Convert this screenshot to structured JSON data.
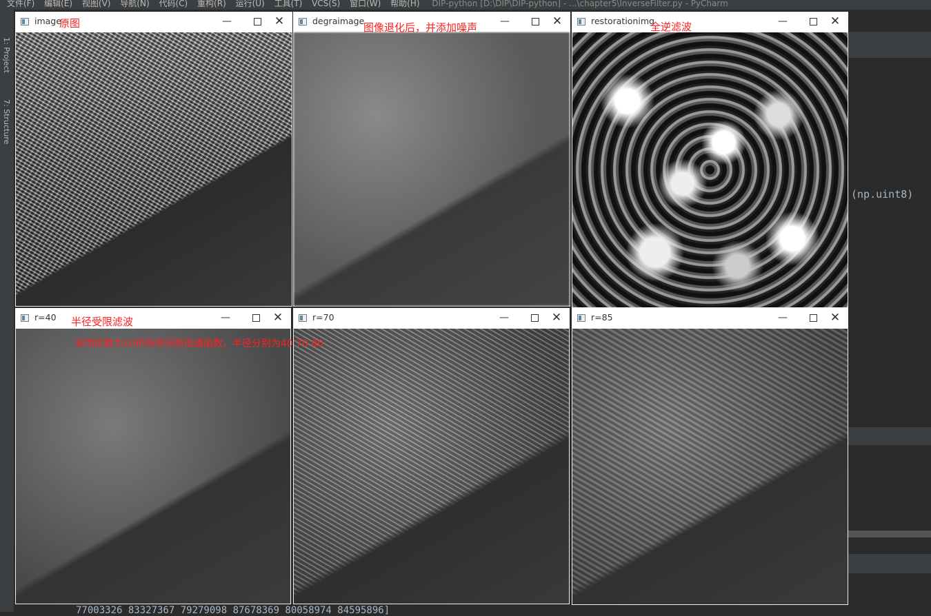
{
  "ide": {
    "menu": [
      "文件(F)",
      "编辑(E)",
      "视图(V)",
      "导航(N)",
      "代码(C)",
      "重构(R)",
      "运行(U)",
      "工具(T)",
      "VCS(S)",
      "窗口(W)",
      "帮助(H)"
    ],
    "title": "DIP-python [D:\\DIP\\DIP-python] - ...\\chapter5\\InverseFilter.py - PyCharm",
    "left_tabs": [
      "1: Project",
      "7: Structure"
    ],
    "code_snippet": "(np.uint8)",
    "console_line": "77003326 83327367  79279098 87678369  80058974 84595896]"
  },
  "windows": [
    {
      "title": "image",
      "note": "原图"
    },
    {
      "title": "degraimage",
      "note": "图像退化后，并添加噪声"
    },
    {
      "title": "restorationimg",
      "note": "全逆滤波"
    },
    {
      "title": "r=40",
      "note": "半径受限滤波"
    },
    {
      "title": "r=70"
    },
    {
      "title": "r=85"
    }
  ],
  "window_controls": {
    "minimize": "—",
    "maximize": "",
    "close": "✕"
  },
  "annotation": "采用阶数为10的布特沃斯低通函数，半径分别为40 70  80"
}
